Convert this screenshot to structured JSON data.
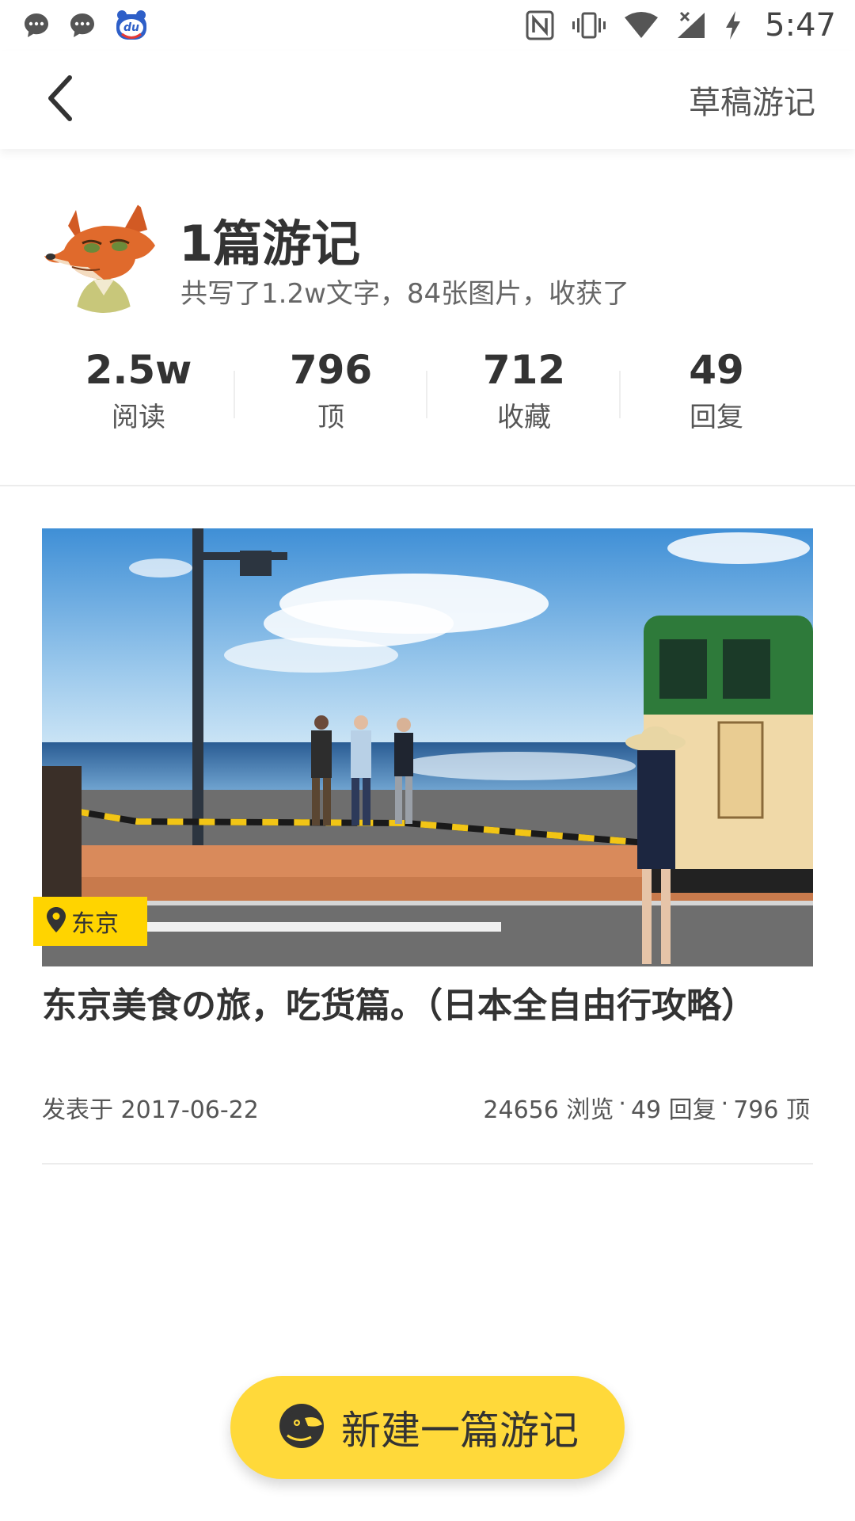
{
  "status_bar": {
    "time": "5:47",
    "left_icons": [
      "chat-bubble-icon",
      "chat-bubble-icon",
      "baidu-du-app-icon"
    ],
    "right_icons": [
      "nfc-icon",
      "vibrate-icon",
      "wifi-icon",
      "signal-icon",
      "charging-icon"
    ]
  },
  "nav": {
    "back_icon": "chevron-left-icon",
    "draft_label": "草稿游记"
  },
  "profile": {
    "title": "1篇游记",
    "subtitle": "共写了1.2w文字，84张图片，收获了"
  },
  "stats": [
    {
      "value": "2.5w",
      "label": "阅读"
    },
    {
      "value": "796",
      "label": "顶"
    },
    {
      "value": "712",
      "label": "收藏"
    },
    {
      "value": "49",
      "label": "回复"
    }
  ],
  "card": {
    "location": "东京",
    "title": "东京美食の旅，吃货篇。（日本全自由行攻略）",
    "date": "发表于 2017-06-22",
    "views": "24656 浏览",
    "replies": "49 回复",
    "likes": "796 顶",
    "separator": "·"
  },
  "new_button": {
    "label": "新建一篇游记"
  },
  "colors": {
    "accent_yellow": "#ffd93a",
    "tag_yellow": "#ffd400",
    "text_dark": "#333333"
  }
}
